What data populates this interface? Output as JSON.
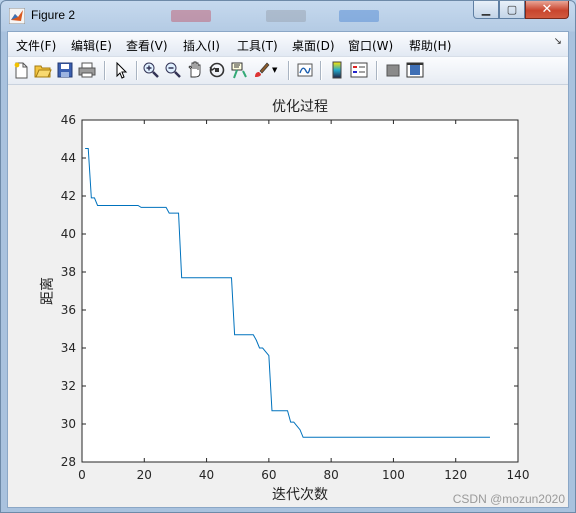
{
  "window": {
    "title": "Figure 2"
  },
  "menu": [
    {
      "label": "文件(F)"
    },
    {
      "label": "编辑(E)"
    },
    {
      "label": "查看(V)"
    },
    {
      "label": "插入(I)"
    },
    {
      "label": "工具(T)"
    },
    {
      "label": "桌面(D)"
    },
    {
      "label": "窗口(W)"
    },
    {
      "label": "帮助(H)"
    }
  ],
  "toolbar_icons": [
    "new-figure-icon",
    "open-icon",
    "save-icon",
    "print-icon",
    "pointer-icon",
    "zoom-in-icon",
    "zoom-out-icon",
    "pan-icon",
    "rotate-3d-icon",
    "data-cursor-icon",
    "brush-icon",
    "link-plot-icon",
    "colorbar-icon",
    "legend-icon",
    "hide-plot-tools-icon",
    "show-plot-tools-icon"
  ],
  "watermark": "CSDN @mozun2020",
  "chart_data": {
    "type": "line",
    "title": "优化过程",
    "xlabel": "迭代次数",
    "ylabel": "距离",
    "xlim": [
      0,
      140
    ],
    "ylim": [
      28,
      46
    ],
    "xticks": [
      0,
      20,
      40,
      60,
      80,
      100,
      120,
      140
    ],
    "yticks": [
      28,
      30,
      32,
      34,
      36,
      38,
      40,
      42,
      44,
      46
    ],
    "grid": false,
    "color": "#0072bd",
    "series": [
      {
        "x": [
          1,
          2,
          3,
          4,
          5,
          18,
          19,
          27,
          28,
          31,
          32,
          48,
          49,
          55,
          56,
          57,
          58,
          59,
          60,
          61,
          62,
          66,
          67,
          68,
          69,
          70,
          71,
          131
        ],
        "y": [
          44.5,
          44.5,
          41.9,
          41.9,
          41.5,
          41.5,
          41.4,
          41.4,
          41.1,
          41.1,
          37.7,
          37.7,
          34.7,
          34.7,
          34.4,
          34.0,
          34.0,
          33.8,
          33.6,
          30.7,
          30.7,
          30.7,
          30.1,
          30.1,
          29.9,
          29.7,
          29.3,
          29.3
        ]
      }
    ]
  }
}
